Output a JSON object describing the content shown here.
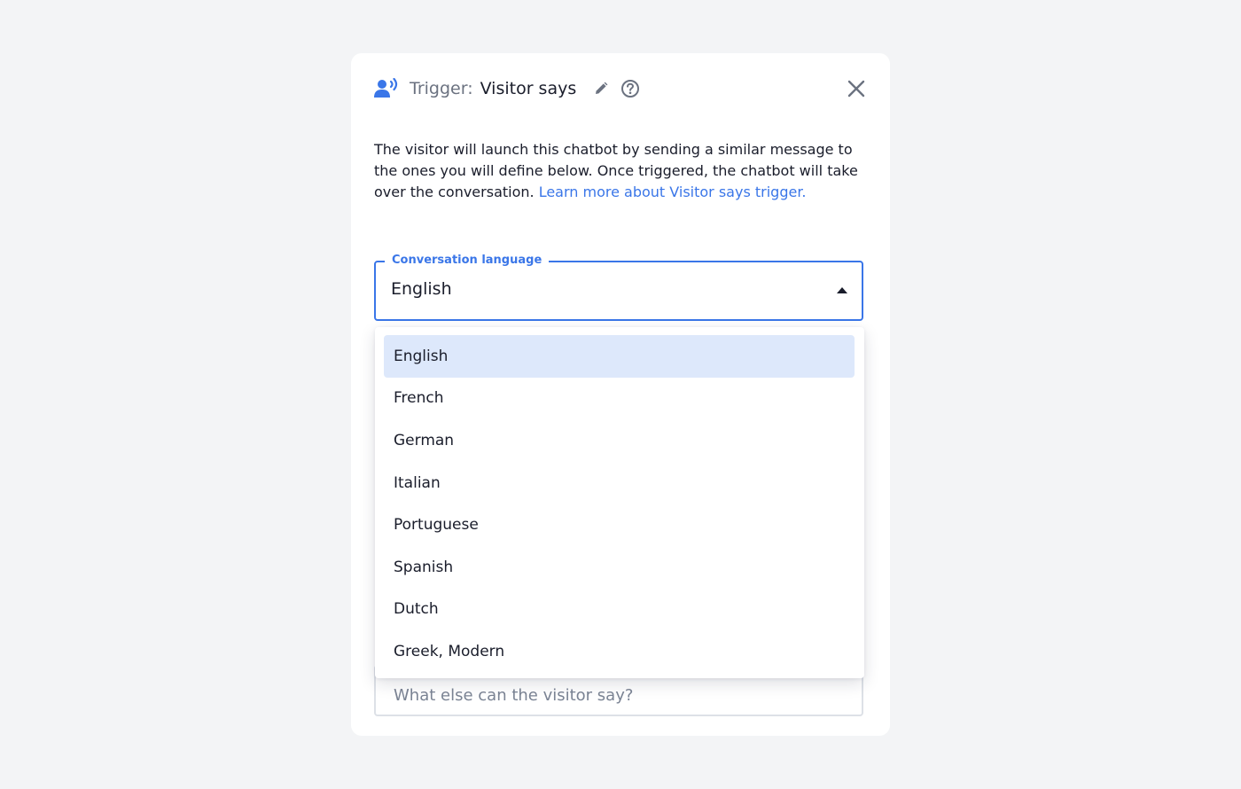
{
  "header": {
    "prefix": "Trigger:",
    "title": "Visitor says",
    "icons": [
      "visitor-speaking-icon",
      "pencil-icon",
      "help-circle-icon",
      "close-icon"
    ]
  },
  "description": {
    "text": "The visitor will launch this chatbot by sending a similar message to the ones you will define below. Once triggered, the chatbot will take over the conversation.",
    "link_text": "Learn more about Visitor says trigger."
  },
  "language_select": {
    "label": "Conversation language",
    "value": "English",
    "options": [
      {
        "label": "English",
        "selected": true
      },
      {
        "label": "French",
        "selected": false
      },
      {
        "label": "German",
        "selected": false
      },
      {
        "label": "Italian",
        "selected": false
      },
      {
        "label": "Portuguese",
        "selected": false
      },
      {
        "label": "Spanish",
        "selected": false
      },
      {
        "label": "Dutch",
        "selected": false
      },
      {
        "label": "Greek, Modern",
        "selected": false
      }
    ]
  },
  "message_input": {
    "placeholder": "What else can the visitor say?",
    "value": ""
  },
  "colors": {
    "accent": "#3a76e8",
    "selected_option_bg": "#dde8fb",
    "page_bg": "#f3f4f6",
    "muted_text": "#6b7280"
  }
}
